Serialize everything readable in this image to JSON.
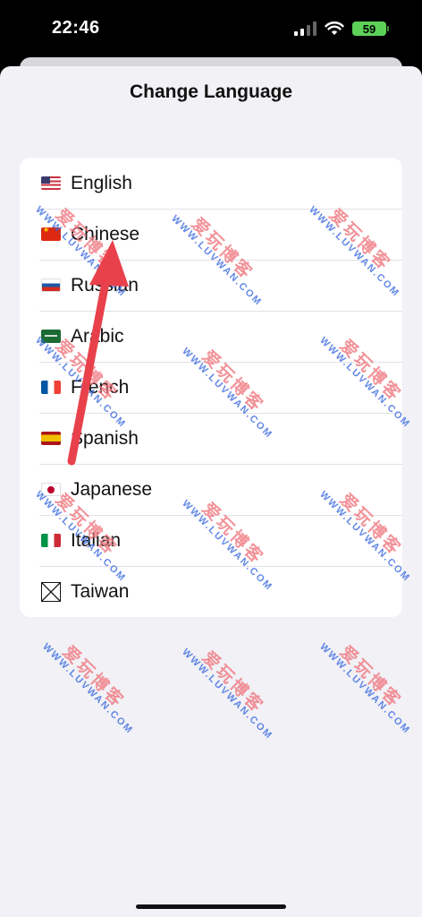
{
  "status_bar": {
    "time": "22:46",
    "battery": "59"
  },
  "sheet": {
    "title": "Change Language"
  },
  "languages": [
    {
      "label": "English",
      "flag": "us-flag-icon"
    },
    {
      "label": "Chinese",
      "flag": "cn-flag-icon"
    },
    {
      "label": "Russian",
      "flag": "ru-flag-icon"
    },
    {
      "label": "Arabic",
      "flag": "sa-flag-icon"
    },
    {
      "label": "French",
      "flag": "fr-flag-icon"
    },
    {
      "label": "Spanish",
      "flag": "es-flag-icon"
    },
    {
      "label": "Japanese",
      "flag": "jp-flag-icon"
    },
    {
      "label": "Italian",
      "flag": "it-flag-icon"
    },
    {
      "label": "Taiwan",
      "flag": "missing-glyph-icon"
    }
  ],
  "watermark": {
    "cn": "爱玩博客",
    "url": "WWW.LUVWAN.COM"
  },
  "annotation": {
    "arrow_color": "#e8414c"
  }
}
